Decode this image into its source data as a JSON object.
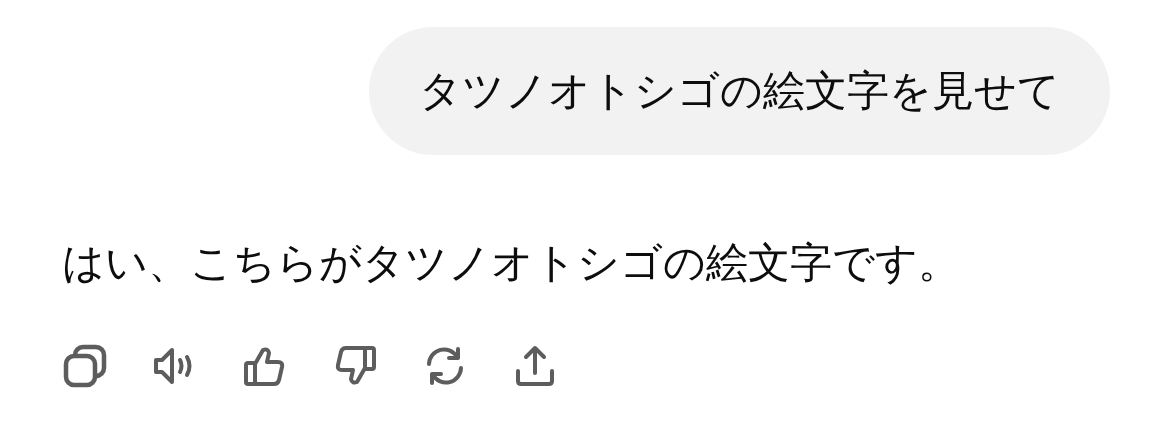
{
  "user_message": "タツノオトシゴの絵文字を見せて",
  "assistant_message": "はい、こちらがタツノオトシゴの絵文字です。"
}
